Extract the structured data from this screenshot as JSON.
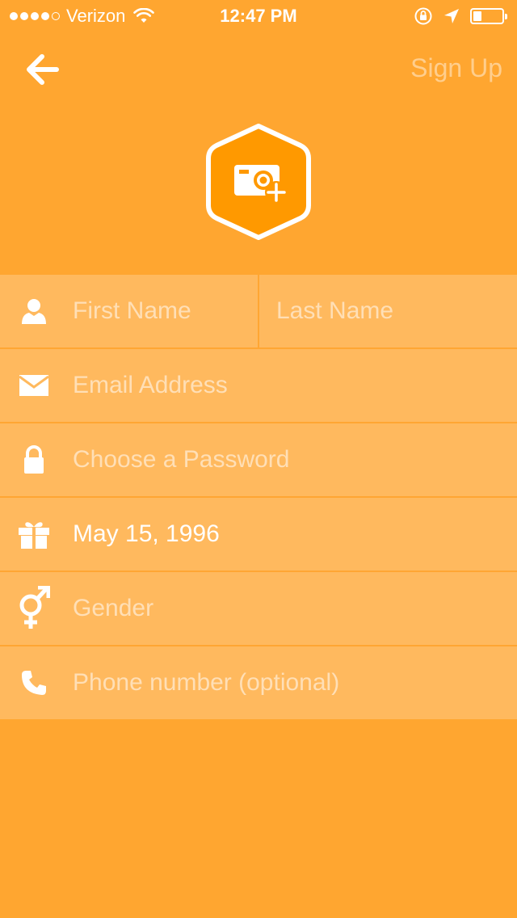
{
  "status_bar": {
    "carrier": "Verizon",
    "time": "12:47 PM",
    "signal_bars_filled": 4,
    "signal_bars_total": 5,
    "battery_level": 0.3
  },
  "nav": {
    "back_icon": "arrow-left-icon",
    "signup_label": "Sign Up"
  },
  "photo": {
    "icon": "camera-add-icon"
  },
  "form": {
    "first_name_placeholder": "First Name",
    "last_name_placeholder": "Last Name",
    "email_placeholder": "Email Address",
    "password_placeholder": "Choose a Password",
    "birthday_value": "May 15, 1996",
    "gender_placeholder": "Gender",
    "phone_placeholder": "Phone number (optional)"
  },
  "colors": {
    "background": "#FFA630",
    "form_background": "#FFB95E",
    "accent": "#FF9900"
  }
}
